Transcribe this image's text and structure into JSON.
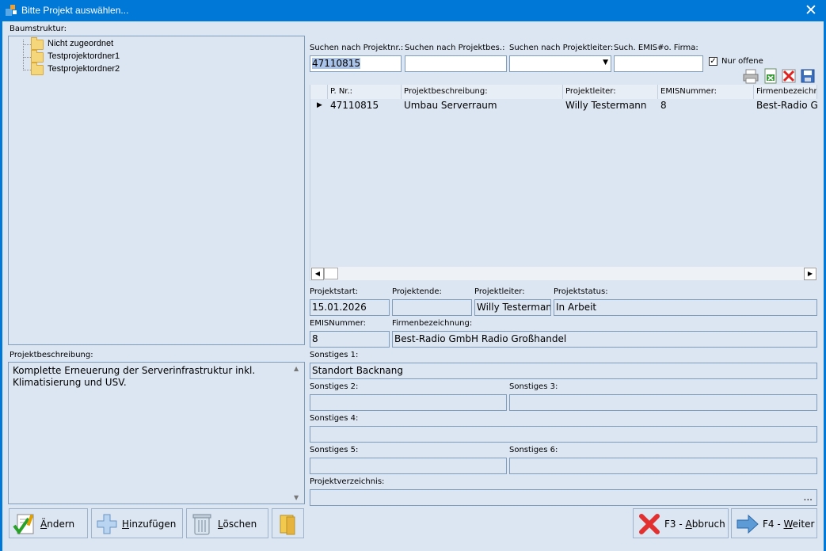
{
  "window": {
    "title": "Bitte Projekt auswählen...",
    "close_glyph": "✕"
  },
  "tree": {
    "label": "Baumstruktur:",
    "items": [
      "Nicht zugeordnet",
      "Testprojektordner1",
      "Testprojektordner2"
    ]
  },
  "search": {
    "projektnr_label": "Suchen nach Projektnr.:",
    "projektnr_value": "47110815",
    "projektbes_label": "Suchen nach Projektbes.:",
    "projektbes_value": "",
    "projektleiter_label": "Suchen nach Projektleiter:",
    "projektleiter_value": "",
    "emis_label": "Such. EMIS#o. Firma:",
    "emis_value": "",
    "nur_offene_label": "Nur offene",
    "nur_offene_checked": true
  },
  "toolbar_icons": [
    "printer-icon",
    "excel-export-icon",
    "delete-x-icon",
    "save-disk-icon"
  ],
  "grid": {
    "columns": [
      "P. Nr.:",
      "Projektbeschreibung:",
      "Projektleiter:",
      "EMISNummer:",
      "Firmenbezeichn"
    ],
    "rows": [
      [
        "47110815",
        "Umbau Serverraum",
        "Willy Testermann",
        "8",
        "Best-Radio Gm"
      ]
    ]
  },
  "details": {
    "projektstart_label": "Projektstart:",
    "projektstart_value": "15.01.2026",
    "projektende_label": "Projektende:",
    "projektende_value": "",
    "projektleiter_label": "Projektleiter:",
    "projektleiter_value": "Willy Testermann",
    "projektstatus_label": "Projektstatus:",
    "projektstatus_value": "In Arbeit",
    "emis_label": "EMISNummer:",
    "emis_value": "8",
    "firma_label": "Firmenbezeichnung:",
    "firma_value": "Best-Radio GmbH Radio Großhandel",
    "sonstiges1_label": "Sonstiges 1:",
    "sonstiges1_value": "Standort Backnang",
    "sonstiges2_label": "Sonstiges 2:",
    "sonstiges2_value": "",
    "sonstiges3_label": "Sonstiges 3:",
    "sonstiges3_value": "",
    "sonstiges4_label": "Sonstiges 4:",
    "sonstiges4_value": "",
    "sonstiges5_label": "Sonstiges 5:",
    "sonstiges5_value": "",
    "sonstiges6_label": "Sonstiges 6:",
    "sonstiges6_value": "",
    "verzeichnis_label": "Projektverzeichnis:",
    "verzeichnis_browse": "..."
  },
  "beschreibung": {
    "label": "Projektbeschreibung:",
    "text": "Komplette Erneuerung der Serverinfrastruktur inkl. Klimatisierung und USV."
  },
  "buttons": {
    "aendern_prefix": "Ä",
    "aendern_rest": "ndern",
    "hinzufuegen_prefix": "H",
    "hinzufuegen_rest": "inzufügen",
    "loeschen_prefix": "L",
    "loeschen_rest": "öschen",
    "abbruch_prefix": "F3 - ",
    "abbruch_ul": "A",
    "abbruch_rest": "bbruch",
    "weiter_prefix": "F4 - ",
    "weiter_ul": "W",
    "weiter_rest": "eiter"
  },
  "colors": {
    "titlebar": "#0078d7",
    "background": "#dce6f2",
    "border": "#7f9db9"
  }
}
